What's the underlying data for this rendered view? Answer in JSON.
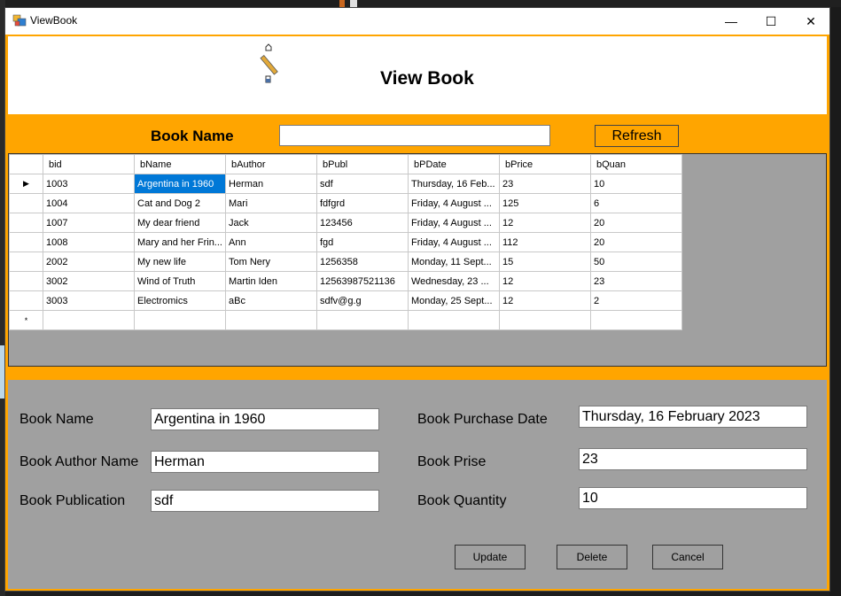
{
  "window": {
    "title": "ViewBook",
    "minimize_glyph": "—",
    "maximize_glyph": "☐",
    "close_glyph": "✕"
  },
  "header": {
    "title": "View Book"
  },
  "search": {
    "label": "Book Name",
    "value": "",
    "refresh_label": "Refresh"
  },
  "grid": {
    "columns": [
      "bid",
      "bName",
      "bAuthor",
      "bPubl",
      "bPDate",
      "bPrice",
      "bQuan"
    ],
    "rows": [
      [
        "1003",
        "Argentina in 1960",
        "Herman",
        "sdf",
        "Thursday, 16 Feb...",
        "23",
        "10"
      ],
      [
        "1004",
        "Cat and Dog 2",
        "Mari",
        "fdfgrd",
        "Friday, 4 August ...",
        "125",
        "6"
      ],
      [
        "1007",
        "My dear friend",
        "Jack",
        "123456",
        "Friday, 4 August ...",
        "12",
        "20"
      ],
      [
        "1008",
        "Mary and her Frin...",
        "Ann",
        "fgd",
        "Friday, 4 August ...",
        "112",
        "20"
      ],
      [
        "2002",
        "My new life",
        "Tom Nery",
        "1256358",
        "Monday, 11 Sept...",
        "15",
        "50"
      ],
      [
        "3002",
        "Wind of Truth",
        "Martin Iden",
        "12563987521136",
        "Wednesday, 23 ...",
        "12",
        "23"
      ],
      [
        "3003",
        "Electromics",
        "aBc",
        "sdfv@g.g",
        "Monday, 25 Sept...",
        "12",
        "2"
      ]
    ],
    "current_row_marker": "▶",
    "new_row_marker": "*"
  },
  "form": {
    "book_name_label": "Book Name",
    "book_name_value": "Argentina in 1960",
    "author_label": "Book Author Name",
    "author_value": "Herman",
    "publication_label": "Book Publication",
    "publication_value": "sdf",
    "purchase_date_label": "Book Purchase Date",
    "purchase_date_value": "Thursday, 16 February 2023",
    "price_label": "Book Prise",
    "price_value": "23",
    "quantity_label": "Book Quantity",
    "quantity_value": "10"
  },
  "buttons": {
    "update": "Update",
    "delete": "Delete",
    "cancel": "Cancel"
  },
  "colors": {
    "form_bg": "#ffa500",
    "panel_bg": "#a0a0a0",
    "selection": "#0078d7"
  }
}
